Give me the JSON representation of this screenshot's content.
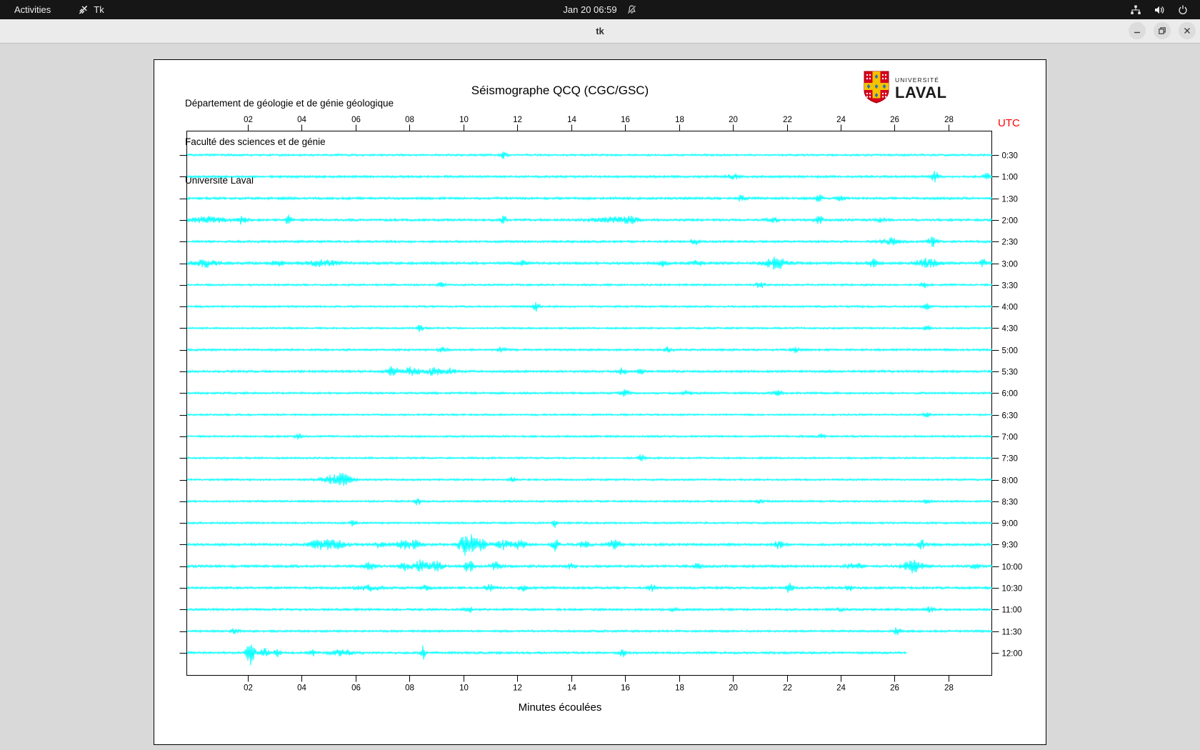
{
  "topbar": {
    "activities_label": "Activities",
    "app_name": "Tk",
    "clock": "Jan 20 06:59"
  },
  "titlebar": {
    "title": "tk"
  },
  "icons": {
    "tk": "tk-feather",
    "bell_muted": "notifications-disabled",
    "network": "wired-network-tree",
    "volume": "speaker-on",
    "power": "power-circle",
    "minimize": "–",
    "restore": "❐",
    "close": "✕"
  },
  "colors": {
    "trace": "#00ffff",
    "utc_red": "#ff0000",
    "axis": "#000000",
    "laval_red": "#d6001c",
    "laval_yellow": "#f3c300",
    "laval_blue": "#2f6fb5"
  },
  "canvas": {
    "header_lines": [
      "Département de géologie et de génie géologique",
      "Faculté des sciences et de génie",
      "Université Laval"
    ],
    "title": "Séismographe QCQ (CGC/GSC)",
    "utc_label": "UTC",
    "xlabel": "Minutes écoulées",
    "logo": {
      "line1": "UNIVERSITÉ",
      "line2": "LAVAL"
    }
  },
  "chart_data": {
    "type": "line",
    "title": "Séismographe QCQ (CGC/GSC)",
    "xlabel": "Minutes écoulées",
    "ylabel": "UTC",
    "x_range_minutes": [
      0,
      30
    ],
    "x_ticks": [
      "02",
      "04",
      "06",
      "08",
      "10",
      "12",
      "14",
      "16",
      "18",
      "20",
      "22",
      "24",
      "26",
      "28"
    ],
    "grid": false,
    "legend": "none",
    "note": "24 half-hour seismogram traces; events = [minute, amplitude_px, width_min]",
    "rows": [
      {
        "utc": "0:30",
        "base": 1.4,
        "events": [
          [
            11.5,
            5,
            0.08
          ]
        ]
      },
      {
        "utc": "1:00",
        "base": 1.6,
        "events": [
          [
            20,
            3.5,
            0.15
          ],
          [
            27.5,
            7,
            0.1
          ],
          [
            29.4,
            6,
            0.08
          ]
        ]
      },
      {
        "utc": "1:30",
        "base": 1.7,
        "events": [
          [
            20.3,
            3.5,
            0.12
          ],
          [
            23.2,
            4,
            0.1
          ],
          [
            24,
            3.5,
            0.1
          ]
        ]
      },
      {
        "utc": "2:00",
        "base": 1.7,
        "events": [
          [
            0.5,
            4,
            0.5
          ],
          [
            1.8,
            6,
            0.1
          ],
          [
            3.5,
            6.5,
            0.08
          ],
          [
            11.5,
            5,
            0.08
          ],
          [
            15.5,
            3.5,
            0.5
          ],
          [
            16.2,
            4,
            0.2
          ],
          [
            21.5,
            3,
            0.15
          ],
          [
            23.2,
            5,
            0.12
          ],
          [
            25.5,
            3,
            0.1
          ]
        ]
      },
      {
        "utc": "2:30",
        "base": 1.6,
        "events": [
          [
            18.6,
            4,
            0.12
          ],
          [
            25.9,
            5,
            0.25
          ],
          [
            27.4,
            7,
            0.12
          ]
        ]
      },
      {
        "utc": "3:00",
        "base": 1.8,
        "events": [
          [
            0.4,
            5,
            0.3
          ],
          [
            3.1,
            4,
            0.15
          ],
          [
            4.8,
            4,
            0.4
          ],
          [
            12.2,
            4,
            0.12
          ],
          [
            17.4,
            3.5,
            0.12
          ],
          [
            18.7,
            4,
            0.12
          ],
          [
            21.6,
            8,
            0.3
          ],
          [
            25.2,
            5,
            0.15
          ],
          [
            27.2,
            6,
            0.3
          ],
          [
            29.3,
            5,
            0.1
          ]
        ]
      },
      {
        "utc": "3:30",
        "base": 1.4,
        "events": [
          [
            9.2,
            3.5,
            0.1
          ],
          [
            21,
            4.5,
            0.1
          ],
          [
            27.1,
            3.5,
            0.1
          ]
        ]
      },
      {
        "utc": "4:00",
        "base": 1.4,
        "events": [
          [
            12.7,
            7.5,
            0.07
          ],
          [
            27.2,
            3.5,
            0.1
          ]
        ]
      },
      {
        "utc": "4:30",
        "base": 1.3,
        "events": [
          [
            8.4,
            5.5,
            0.08
          ],
          [
            27.2,
            3.5,
            0.08
          ]
        ]
      },
      {
        "utc": "5:00",
        "base": 1.5,
        "events": [
          [
            9.2,
            3.5,
            0.1
          ],
          [
            11.4,
            3.5,
            0.1
          ],
          [
            17.6,
            4.5,
            0.1
          ],
          [
            22.3,
            3.5,
            0.1
          ]
        ]
      },
      {
        "utc": "5:30",
        "base": 1.6,
        "events": [
          [
            7.4,
            7,
            0.15
          ],
          [
            8.1,
            6.5,
            0.2
          ],
          [
            8.9,
            5,
            0.2
          ],
          [
            9.5,
            4,
            0.15
          ],
          [
            15.9,
            4.5,
            0.1
          ],
          [
            16.6,
            3.5,
            0.1
          ]
        ]
      },
      {
        "utc": "6:00",
        "base": 1.5,
        "events": [
          [
            16,
            5,
            0.1
          ],
          [
            18.3,
            3.5,
            0.1
          ],
          [
            21.7,
            4.5,
            0.12
          ]
        ]
      },
      {
        "utc": "6:30",
        "base": 1.3,
        "events": [
          [
            27.2,
            3,
            0.1
          ]
        ]
      },
      {
        "utc": "7:00",
        "base": 1.4,
        "events": [
          [
            3.9,
            4.5,
            0.08
          ],
          [
            23.3,
            3.5,
            0.1
          ]
        ]
      },
      {
        "utc": "7:30",
        "base": 1.3,
        "events": [
          [
            16.6,
            4.5,
            0.08
          ]
        ]
      },
      {
        "utc": "8:00",
        "base": 1.4,
        "events": [
          [
            5.2,
            6,
            0.35
          ],
          [
            5.6,
            5,
            0.2
          ],
          [
            11.8,
            4.5,
            0.07
          ]
        ]
      },
      {
        "utc": "8:30",
        "base": 1.4,
        "events": [
          [
            8.3,
            5,
            0.07
          ],
          [
            21,
            2.5,
            0.1
          ],
          [
            27.2,
            3,
            0.08
          ]
        ]
      },
      {
        "utc": "9:00",
        "base": 1.4,
        "events": [
          [
            5.9,
            4.5,
            0.08
          ],
          [
            13.4,
            8,
            0.05
          ]
        ]
      },
      {
        "utc": "9:30",
        "base": 1.8,
        "events": [
          [
            4.7,
            6,
            0.3
          ],
          [
            5.3,
            5,
            0.25
          ],
          [
            6.9,
            4.5,
            0.12
          ],
          [
            7.8,
            6,
            0.2
          ],
          [
            8.2,
            5,
            0.15
          ],
          [
            10.1,
            12,
            0.2
          ],
          [
            10.5,
            9,
            0.25
          ],
          [
            11.5,
            6,
            0.2
          ],
          [
            12.1,
            6,
            0.15
          ],
          [
            13.4,
            8,
            0.1
          ],
          [
            14.5,
            5,
            0.12
          ],
          [
            15.6,
            6,
            0.18
          ],
          [
            21.7,
            5,
            0.12
          ],
          [
            27,
            6,
            0.1
          ]
        ]
      },
      {
        "utc": "10:00",
        "base": 1.8,
        "events": [
          [
            6.5,
            5,
            0.15
          ],
          [
            7.8,
            6,
            0.12
          ],
          [
            8.4,
            8,
            0.2
          ],
          [
            9,
            7,
            0.15
          ],
          [
            10.2,
            8,
            0.12
          ],
          [
            11.2,
            5,
            0.15
          ],
          [
            14,
            3.5,
            0.1
          ],
          [
            18.7,
            4.5,
            0.1
          ],
          [
            24.5,
            4,
            0.2
          ],
          [
            26.7,
            9,
            0.25
          ],
          [
            29,
            4,
            0.1
          ]
        ]
      },
      {
        "utc": "10:30",
        "base": 1.7,
        "events": [
          [
            6.5,
            4,
            0.3
          ],
          [
            8.6,
            4,
            0.12
          ],
          [
            11,
            5,
            0.12
          ],
          [
            12.2,
            4,
            0.1
          ],
          [
            17,
            4,
            0.1
          ],
          [
            22.1,
            7,
            0.08
          ],
          [
            24.3,
            6,
            0.08
          ]
        ]
      },
      {
        "utc": "11:00",
        "base": 1.6,
        "events": [
          [
            10.2,
            4.5,
            0.1
          ],
          [
            17.8,
            4,
            0.1
          ],
          [
            24,
            3,
            0.1
          ],
          [
            27.3,
            3.5,
            0.1
          ]
        ]
      },
      {
        "utc": "11:30",
        "base": 1.5,
        "events": [
          [
            1.5,
            3,
            0.1
          ],
          [
            26.1,
            5,
            0.1
          ]
        ]
      },
      {
        "utc": "12:00",
        "base": 1.6,
        "end": 26.45,
        "events": [
          [
            2.1,
            20,
            0.1
          ],
          [
            2.6,
            7,
            0.12
          ],
          [
            3.1,
            5,
            0.1
          ],
          [
            4.4,
            5,
            0.08
          ],
          [
            5.5,
            4,
            0.3
          ],
          [
            8.5,
            10,
            0.06
          ],
          [
            15.9,
            6,
            0.07
          ]
        ]
      }
    ]
  }
}
